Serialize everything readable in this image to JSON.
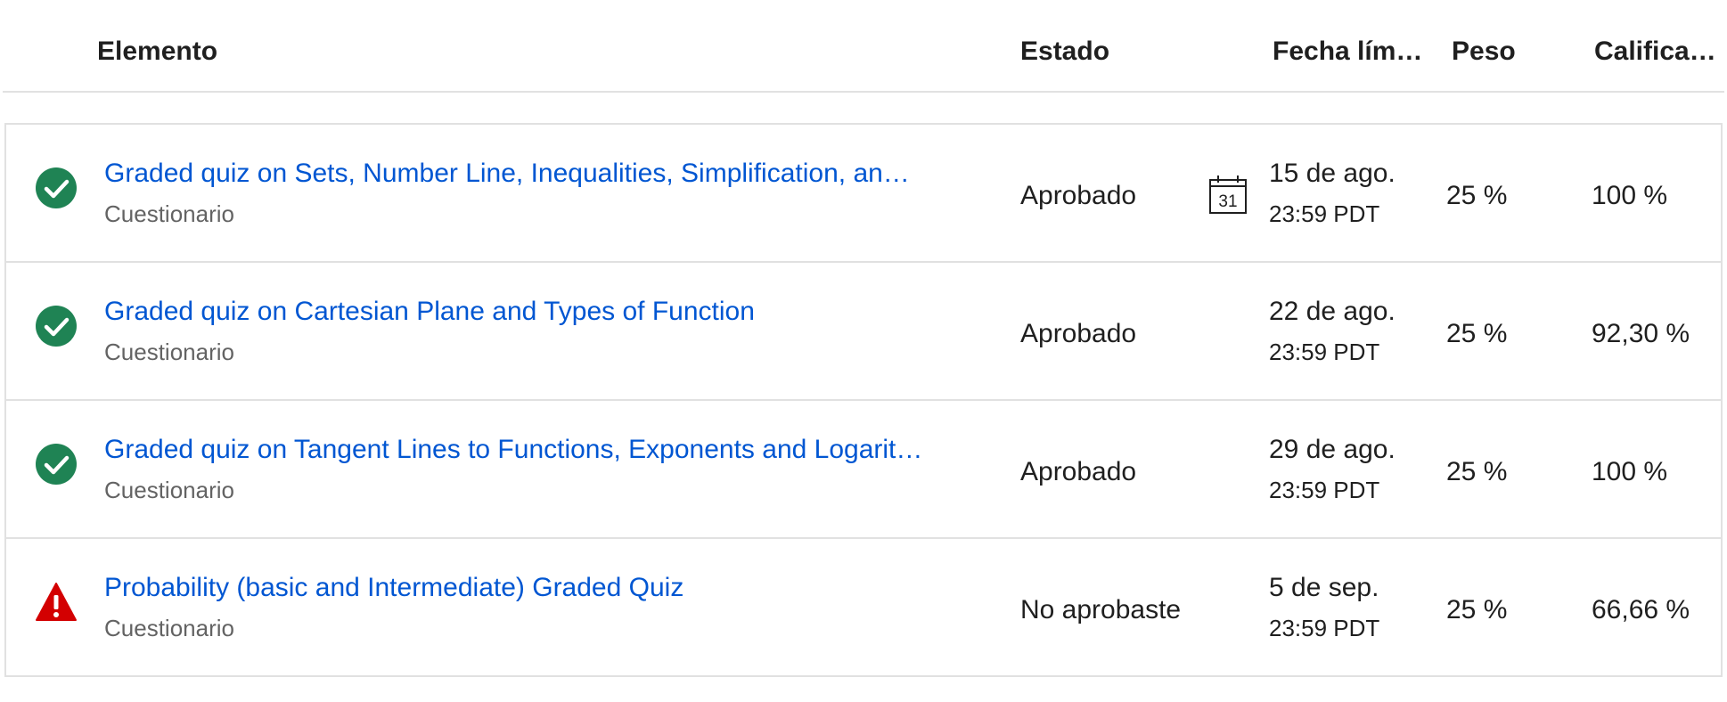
{
  "columns": {
    "item": "Elemento",
    "status": "Estado",
    "due": "Fecha lím…",
    "weight": "Peso",
    "grade": "Califica…"
  },
  "rows": [
    {
      "title": "Graded quiz on Sets, Number Line, Inequalities, Simplification, an…",
      "type": "Cuestionario",
      "status": "Aprobado",
      "status_icon": "check-circle-icon",
      "due_date": "15 de ago.",
      "due_time": "23:59 PDT",
      "calendar_day": "31",
      "weight": "25 %",
      "grade": "100 %"
    },
    {
      "title": "Graded quiz on Cartesian Plane and Types of Function",
      "type": "Cuestionario",
      "status": "Aprobado",
      "status_icon": "check-circle-icon",
      "due_date": "22 de ago.",
      "due_time": "23:59 PDT",
      "weight": "25 %",
      "grade": "92,30 %"
    },
    {
      "title": "Graded quiz on Tangent Lines to Functions, Exponents and Logarit…",
      "type": "Cuestionario",
      "status": "Aprobado",
      "status_icon": "check-circle-icon",
      "due_date": "29 de ago.",
      "due_time": "23:59 PDT",
      "weight": "25 %",
      "grade": "100 %"
    },
    {
      "title": "Probability (basic and Intermediate) Graded Quiz",
      "type": "Cuestionario",
      "status": "No aprobaste",
      "status_icon": "warning-triangle-icon",
      "due_date": "5 de sep.",
      "due_time": "23:59 PDT",
      "weight": "25 %",
      "grade": "66,66 %"
    }
  ],
  "colors": {
    "link": "#0056d2",
    "pass": "#1f8354",
    "fail": "#d30001",
    "border": "#e1e1e1",
    "secondary_text": "#636363"
  }
}
